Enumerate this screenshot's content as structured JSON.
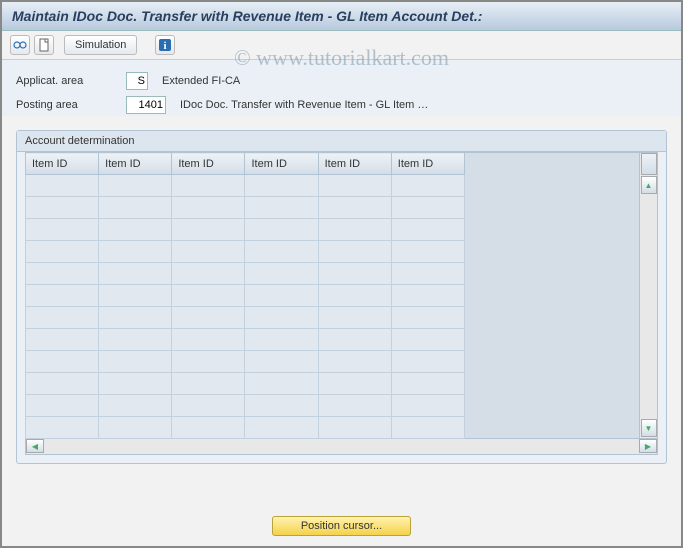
{
  "title": "Maintain IDoc Doc. Transfer with Revenue Item - GL Item Account Det.:",
  "watermark": "© www.tutorialkart.com",
  "toolbar": {
    "simulation_label": "Simulation"
  },
  "fields": {
    "applicat_area_label": "Applicat. area",
    "applicat_area_value": "S",
    "applicat_area_desc": "Extended FI-CA",
    "posting_area_label": "Posting area",
    "posting_area_value": "1401",
    "posting_area_desc": "IDoc Doc. Transfer with Revenue Item - GL Item …"
  },
  "panel": {
    "title": "Account determination",
    "columns": [
      "Item ID",
      "Item ID",
      "Item ID",
      "Item ID",
      "Item ID",
      "Item ID"
    ],
    "row_count": 12
  },
  "action": {
    "position_cursor_label": "Position cursor..."
  }
}
